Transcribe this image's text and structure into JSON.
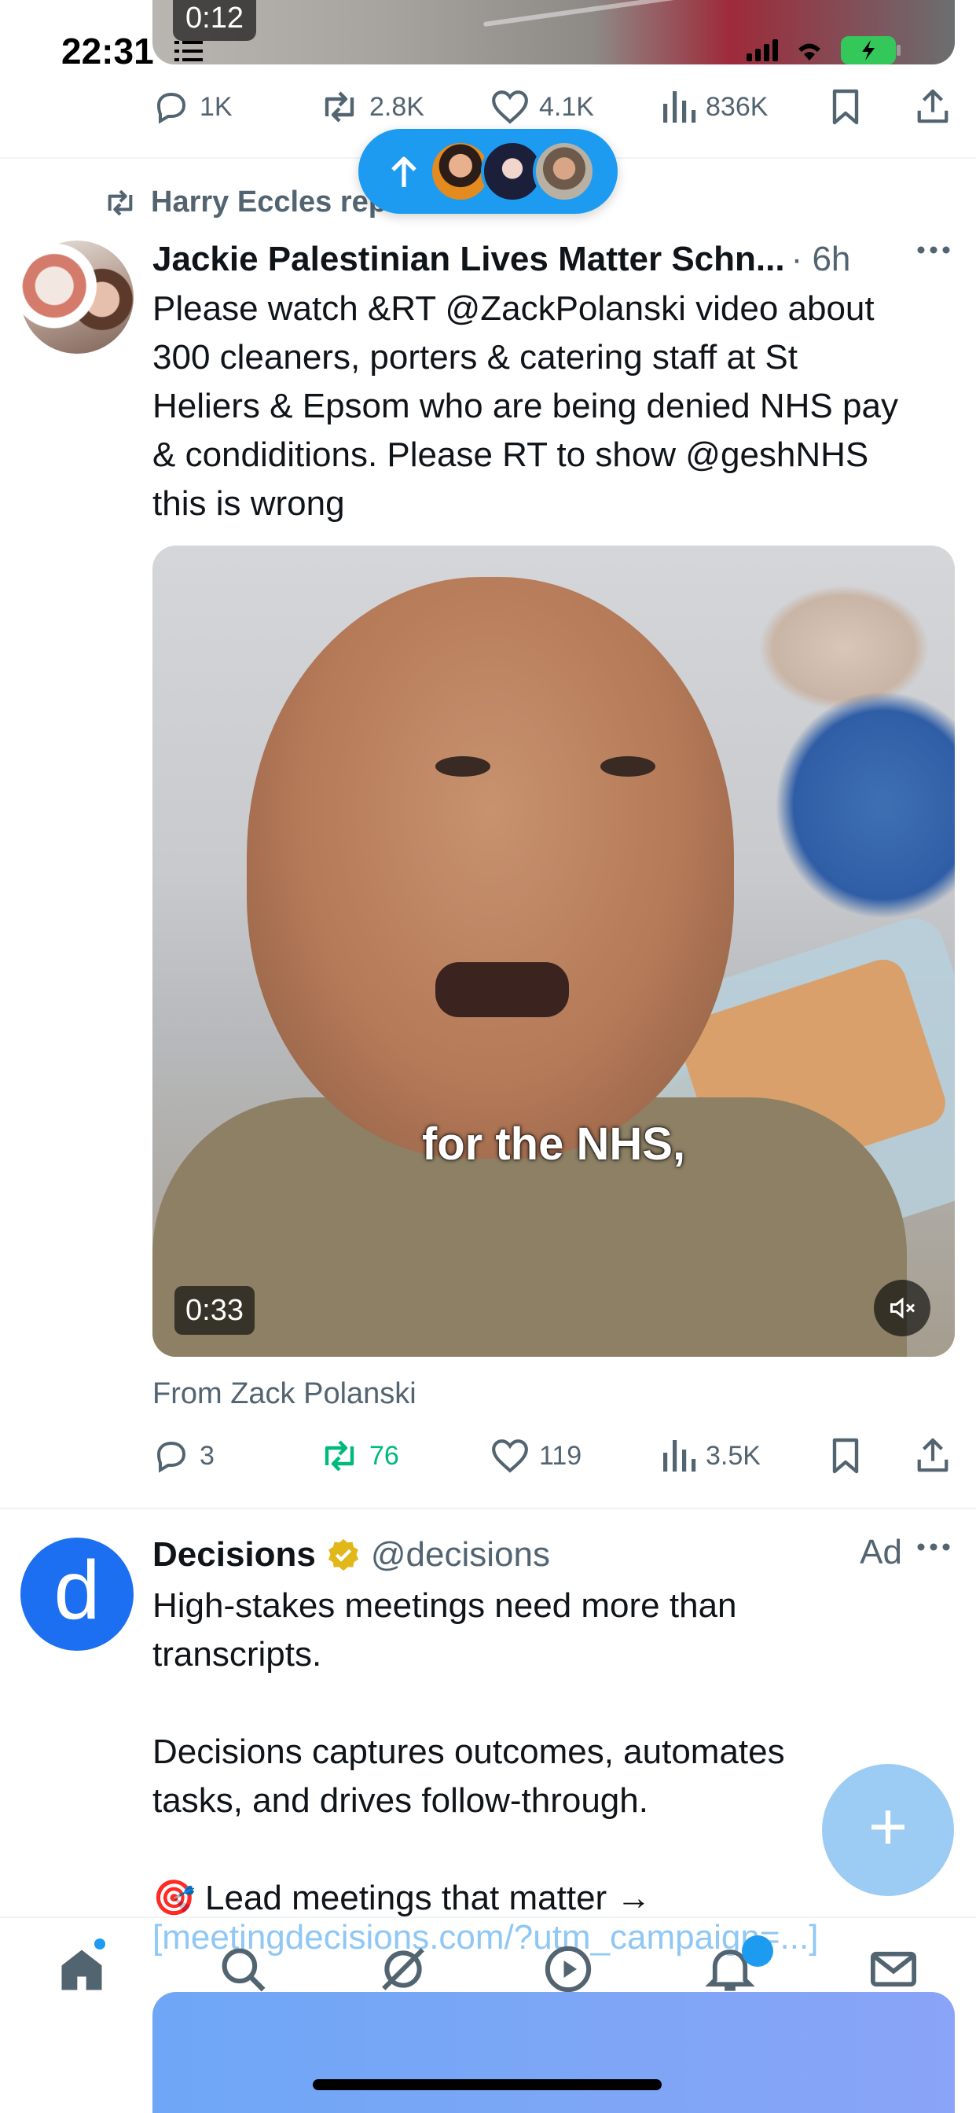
{
  "status_bar": {
    "time": "22:31"
  },
  "prev_tweet": {
    "video_duration": "0:12",
    "stats": {
      "replies": "1K",
      "reposts": "2.8K",
      "likes": "4.1K",
      "views": "836K"
    }
  },
  "repost_banner": {
    "text": "Harry Eccles reposted"
  },
  "tweet1": {
    "name": "Jackie Palestinian Lives Matter Schn...",
    "time": "· 6h",
    "text_lines": [
      "Please watch &RT @ZackPolanski video  about",
      "300 cleaners, porters & catering staff at St",
      "Heliers & Epsom who are being denied NHS pay",
      "& condiditions. Please RT to show @geshNHS",
      "this is wrong"
    ],
    "video": {
      "caption": "for the NHS,",
      "duration": "0:33"
    },
    "source": "From Zack Polanski",
    "stats": {
      "replies": "3",
      "reposts": "76",
      "likes": "119",
      "views": "3.5K"
    },
    "repost_color": "#00ba7c"
  },
  "tweet2": {
    "avatar_letter": "d",
    "name": "Decisions",
    "handle": "@decisions",
    "ad_label": "Ad",
    "text_lines": [
      "High-stakes meetings need more than",
      "transcripts.",
      "",
      "Decisions captures outcomes, automates",
      "tasks, and drives follow-through.",
      "",
      "🎯 Lead meetings that matter →",
      "[meetingdecisions.com/?utm_campaign=...]"
    ]
  },
  "fab": {
    "icon": "+"
  },
  "colors": {
    "accent": "#1d9bf0",
    "muted": "#536471",
    "text": "#0f1419"
  },
  "icons": {
    "nav": [
      "home-icon",
      "search-icon",
      "grok-icon",
      "video-icon",
      "notifications-icon",
      "messages-icon"
    ]
  }
}
